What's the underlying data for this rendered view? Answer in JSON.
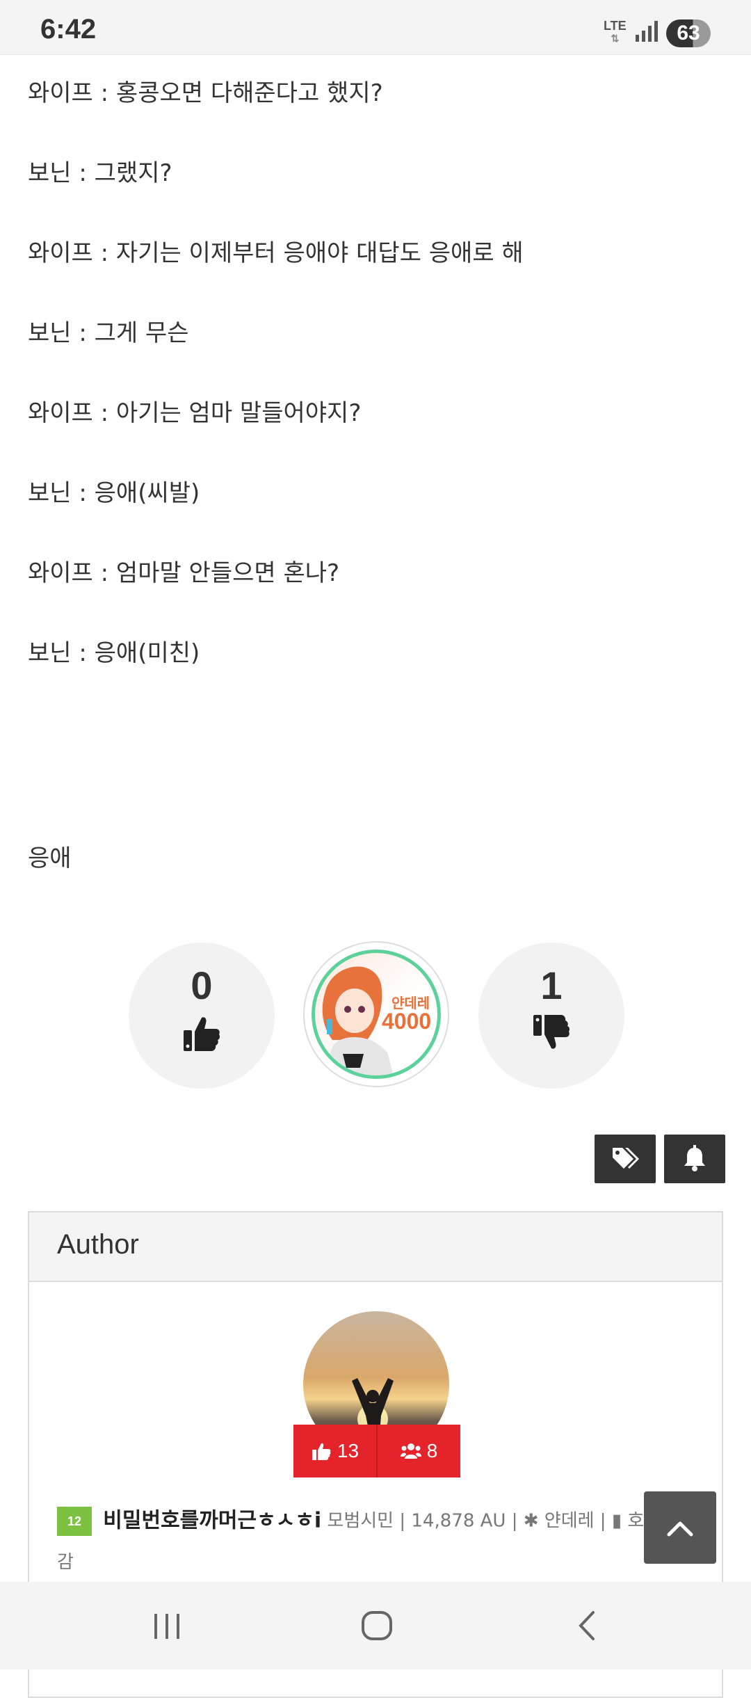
{
  "status_bar": {
    "time": "6:42",
    "network": "LTE",
    "battery": "63"
  },
  "dialogue": [
    "와이프 : 홍콩오면 다해준다고 했지?",
    "보닌 : 그랬지?",
    "와이프 : 자기는 이제부터 응애야 대답도 응애로 해",
    "보닌 : 그게 무슨",
    "와이프 : 아기는 엄마 말들어야지?",
    "보닌 : 응애(씨발)",
    "와이프 : 엄마말 안들으면 혼나?",
    "보닌 : 응애(미친)"
  ],
  "ending": "응애",
  "votes": {
    "up": "0",
    "down": "1"
  },
  "badge": {
    "line1": "얀데레",
    "line2": "4000"
  },
  "author": {
    "title": "Author",
    "likes": "13",
    "followers": "8",
    "level": "12",
    "nickname": "비밀번호를까머근ㅎㅅㅎi",
    "meta": "모범시민 |  14,878 AU | ✱ 얀데레 | ▮ 호",
    "meta_cont": "감"
  },
  "icons": {
    "like": "thumbs-up-icon",
    "dislike": "thumbs-down-icon",
    "tag": "tags-icon",
    "bell": "bell-icon",
    "friends": "users-icon",
    "top": "chevron-up-icon"
  }
}
